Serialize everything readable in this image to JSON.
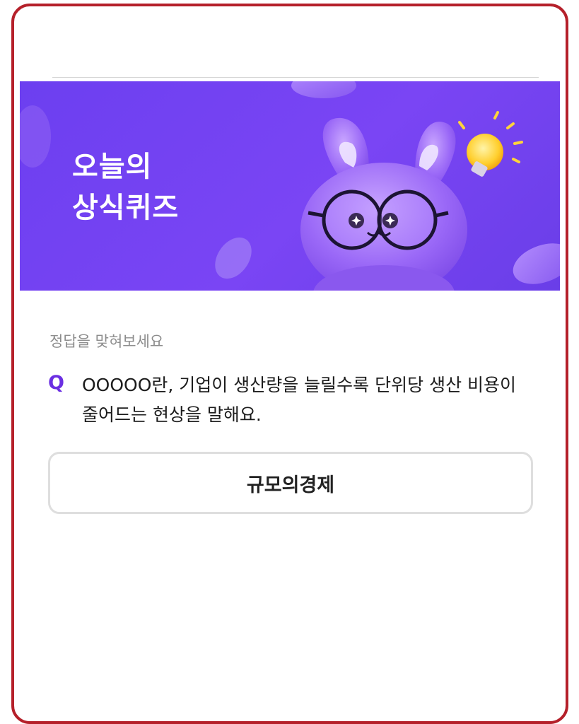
{
  "banner": {
    "title_line1": "오늘의",
    "title_line2": "상식퀴즈",
    "background": "#7544f2",
    "illustration": "purple-rabbit-with-glasses",
    "decor_icon": "lightbulb-icon"
  },
  "quiz": {
    "instruction": "정답을 맞혀보세요",
    "q_label": "Q",
    "question": "OOOOO란, 기업이 생산량을 늘릴수록 단위당 생산 비용이 줄어드는 현상을 말해요.",
    "answer_option": "규모의경제"
  },
  "colors": {
    "frame_border": "#b5202a",
    "accent": "#6b2fe2"
  }
}
